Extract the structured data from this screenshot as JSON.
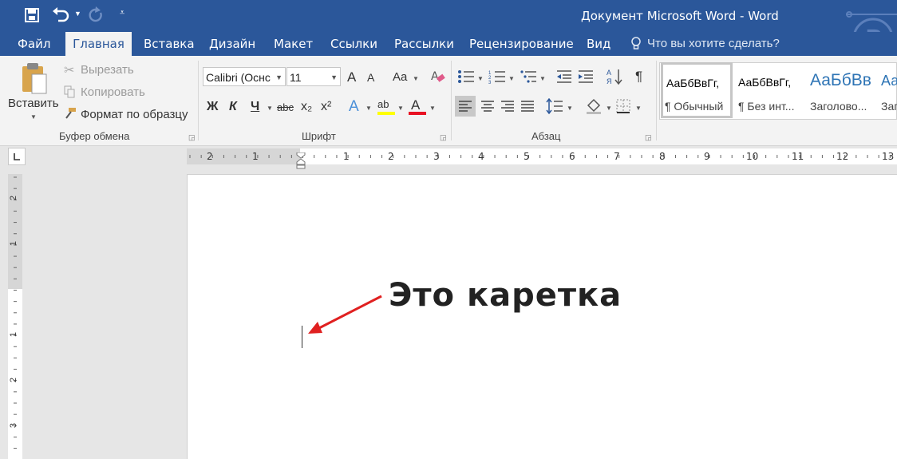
{
  "window": {
    "title": "Документ Microsoft Word  -  Word"
  },
  "tabs": [
    {
      "label": "Файл",
      "active": false
    },
    {
      "label": "Главная",
      "active": true
    },
    {
      "label": "Вставка",
      "active": false
    },
    {
      "label": "Дизайн",
      "active": false
    },
    {
      "label": "Макет",
      "active": false
    },
    {
      "label": "Ссылки",
      "active": false
    },
    {
      "label": "Рассылки",
      "active": false
    },
    {
      "label": "Рецензирование",
      "active": false
    },
    {
      "label": "Вид",
      "active": false
    }
  ],
  "tellme": {
    "placeholder": "Что вы хотите сделать?"
  },
  "clipboard": {
    "paste_label": "Вставить",
    "cut_label": "Вырезать",
    "copy_label": "Копировать",
    "format_painter_label": "Формат по образцу",
    "group_label": "Буфер обмена"
  },
  "font": {
    "font_name": "Calibri (Оснс",
    "font_size": "11",
    "group_label": "Шрифт",
    "bold": "Ж",
    "italic": "К",
    "underline": "Ч",
    "strike": "abc",
    "sub": "x₂",
    "sup": "x²",
    "grow": "A",
    "shrink": "A",
    "case": "Aa",
    "text_effects": "A",
    "highlight": "ab",
    "font_color": "A"
  },
  "paragraph": {
    "group_label": "Абзац",
    "pilcrow": "¶"
  },
  "styles": [
    {
      "preview": "АаБбВвГг,",
      "name": "¶ Обычный"
    },
    {
      "preview": "АаБбВвГг,",
      "name": "¶ Без инт..."
    },
    {
      "preview": "АаБбВв",
      "name": "Заголово..."
    },
    {
      "preview": "Аа",
      "name": "Заг"
    }
  ],
  "ruler": {
    "h_numbers_left": [
      "2",
      "1"
    ],
    "h_numbers_right": [
      "1",
      "2",
      "3",
      "4",
      "5",
      "6",
      "7",
      "8",
      "9",
      "10",
      "11",
      "12",
      "13"
    ],
    "v_numbers_top": [
      "2",
      "1"
    ],
    "v_numbers_bottom": [
      "1",
      "2",
      "3"
    ]
  },
  "annotation": {
    "text": "Это каретка"
  },
  "colors": {
    "brand": "#2b579a",
    "arrow": "#e02020",
    "font_color_bar": "#e81123",
    "highlight_bar": "#ffff00"
  }
}
